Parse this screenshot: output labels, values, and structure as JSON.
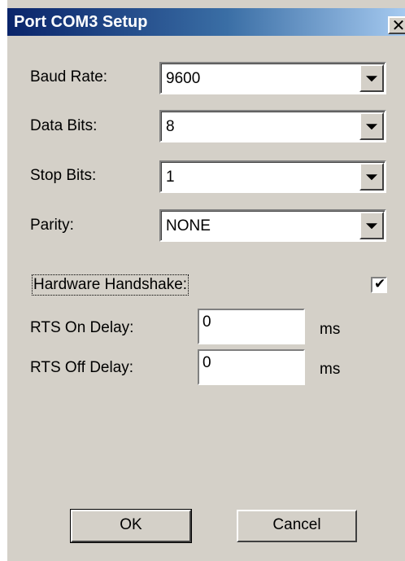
{
  "dialog": {
    "title": "Port COM3 Setup",
    "close_symbol": "✕"
  },
  "fields": {
    "baud_rate": {
      "label": "Baud Rate:",
      "value": "9600"
    },
    "data_bits": {
      "label": "Data Bits:",
      "value": "8"
    },
    "stop_bits": {
      "label": "Stop Bits:",
      "value": "1"
    },
    "parity": {
      "label": "Parity:",
      "value": "NONE"
    },
    "hardware_handshake": {
      "label": "Hardware Handshake:",
      "checked": true,
      "check_symbol": "✔"
    },
    "rts_on_delay": {
      "label": "RTS On Delay:",
      "value": "0",
      "unit": "ms"
    },
    "rts_off_delay": {
      "label": "RTS Off Delay:",
      "value": "0",
      "unit": "ms"
    }
  },
  "buttons": {
    "ok": "OK",
    "cancel": "Cancel"
  }
}
